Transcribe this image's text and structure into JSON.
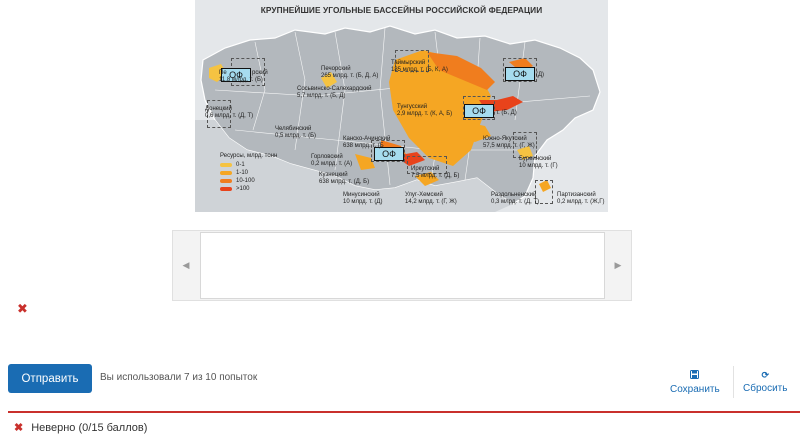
{
  "map": {
    "title": "КРУПНЕЙШИЕ УГОЛЬНЫЕ БАССЕЙНЫ РОССИЙСКОЙ ФЕДЕРАЦИИ",
    "drop_label": "ОФ",
    "labels": {
      "pechora_ru": "Печорский",
      "pechora_left": "Пе",
      "pechora_right": "рский",
      "pechora_val": "11,8 млрд. т. (Б)",
      "pechorsky_name": "Печорский",
      "pechorsky_val": "265 млрд. т. (Б, Д, А)",
      "sosva_name": "Сосьвинско-Салехардский",
      "sosva_val": "5,7 млрд. т. (Б, Д)",
      "taimyr_name": "Таймырский",
      "taimyr_val": "185 млрд. т. (Б, К, А)",
      "donets_name": "Донецкий",
      "donets_val": "0,6 млрд. т. (Д, Т)",
      "tungus_name": "Тунгусский",
      "tungus_val": "2,9 млрд. т. (К, А, Б)",
      "chelyab_name": "Челябинский",
      "chelyab_val": "0,5 млрд. т. (Б)",
      "kansk_name": "Канско-Ачинский",
      "kansk_val": "638 млрд. т. (Б",
      "gorlov_name": "Горловский",
      "gorlov_val": "0,2 млрд. т. (А)",
      "kuzn_name": "Кузнецкий",
      "kuzn_val": "638 млрд. т. (Д, Б)",
      "irkut_name": "Иркутский",
      "irkut_val": "7,5 млрд. т. (Д, Б)",
      "minus_name": "Минусинский",
      "minus_val": "10 млрд. т. (Д)",
      "ulug_name": "Улуг-Хемский",
      "ulug_val": "14,2 млрд. т. (Г, Ж)",
      "yakut_name": "Южно-Якутский",
      "yakut_val": "57,5 млрд. т. (Г, Ж)",
      "bureya_name": "Буреинский",
      "bureya_val": "10 млрд. т. (Г)",
      "razd_name": "Раздольненский",
      "razd_val": "0,3 млрд. т. (Д, Т)",
      "partiz_name": "Партизанский",
      "partiz_val": "0,2 млрд. т. (Ж,Г)",
      "lena_val": "(Д)",
      "zyr_val": "т. (Б, Д)"
    },
    "legend": {
      "title": "Ресурсы, млрд. тонн",
      "items": [
        "0-1",
        "1-10",
        "10-100",
        ">100"
      ],
      "colors": [
        "#f5c342",
        "#f5a623",
        "#f07d1e",
        "#e8431b"
      ]
    }
  },
  "carousel": {
    "prev": "◀",
    "next": "▶"
  },
  "actions": {
    "submit": "Отправить",
    "attempts": "Вы использовали 7 из 10 попыток",
    "save": "Сохранить",
    "reset": "Сбросить"
  },
  "status": {
    "text": "Неверно (0/15 баллов)"
  },
  "colors": {
    "accent": "#1a6cb3",
    "error": "#c9302c"
  }
}
